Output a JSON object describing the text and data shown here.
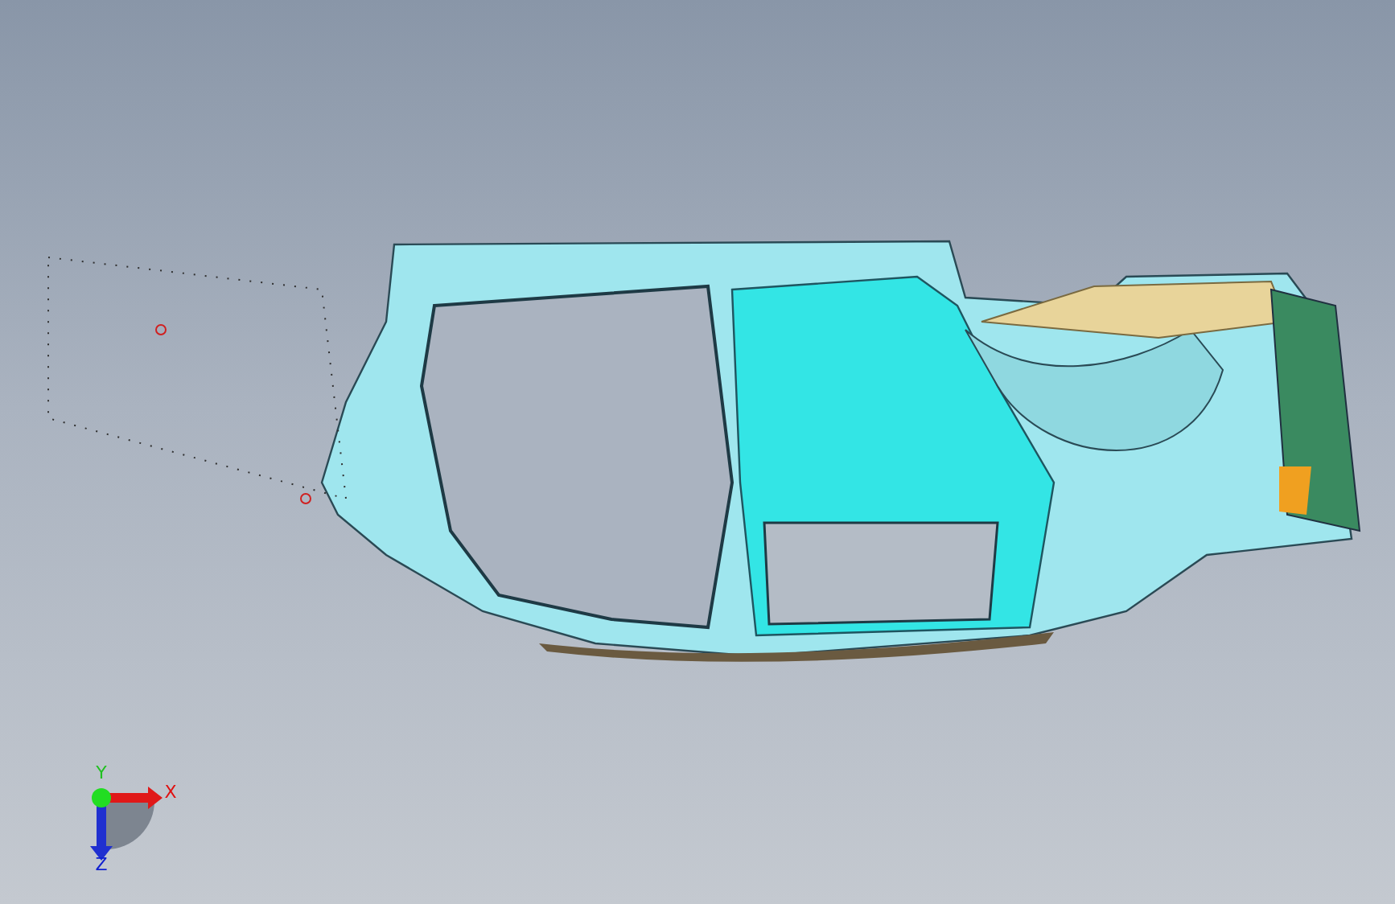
{
  "axis_triad": {
    "labels": [
      {
        "kind": "x",
        "text": "X"
      },
      {
        "kind": "y",
        "text": "Y"
      },
      {
        "kind": "z",
        "text": "Z"
      }
    ]
  }
}
